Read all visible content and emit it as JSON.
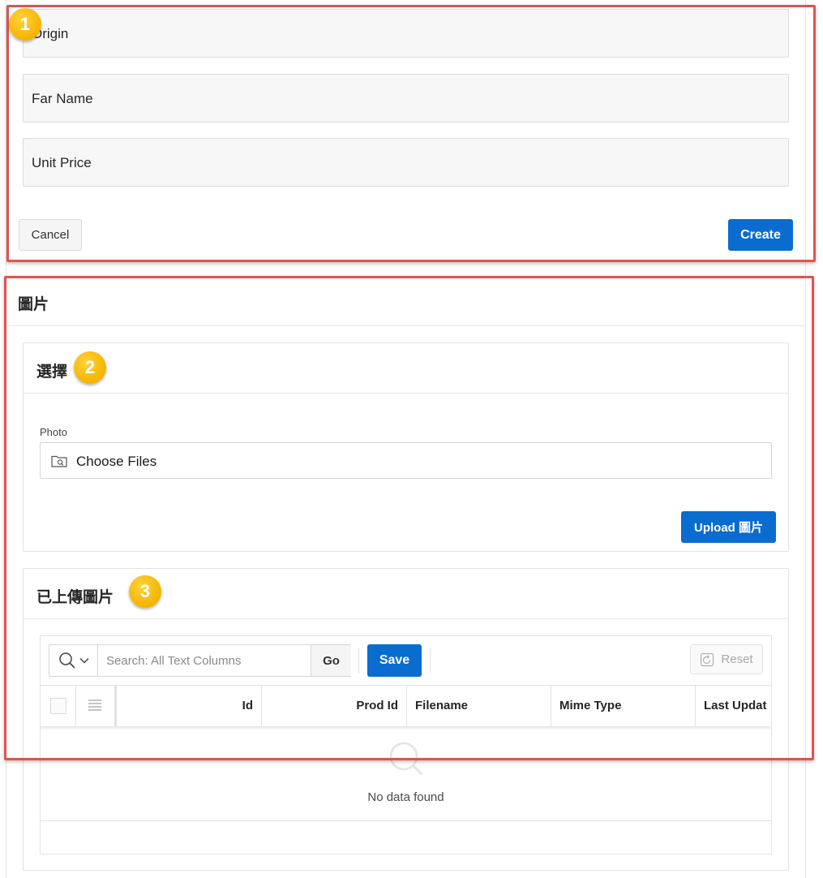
{
  "form": {
    "fields": {
      "origin": "Origin",
      "far_name": "Far Name",
      "unit_price": "Unit Price"
    },
    "cancel_label": "Cancel",
    "create_label": "Create"
  },
  "callouts": {
    "one": "1",
    "two": "2",
    "three": "3"
  },
  "region": {
    "title": "圖片"
  },
  "select_card": {
    "title": "選擇",
    "photo_label": "Photo",
    "choose_files": "Choose Files",
    "upload_label": "Upload 圖片"
  },
  "uploaded_card": {
    "title": "已上傳圖片",
    "search_placeholder": "Search: All Text Columns",
    "go_label": "Go",
    "save_label": "Save",
    "reset_label": "Reset",
    "columns": [
      "Id",
      "Prod Id",
      "Filename",
      "Mime Type",
      "Last Updat"
    ],
    "no_data": "No data found"
  },
  "colors": {
    "primary_button": "#0a6ccf",
    "highlight_border": "#e0544e",
    "callout": "#f4b400"
  }
}
